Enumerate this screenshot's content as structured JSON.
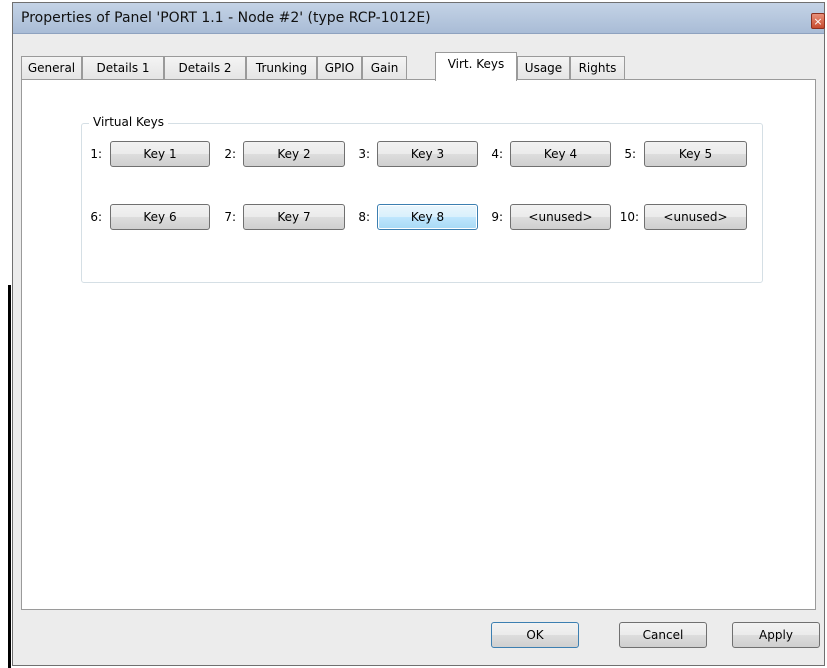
{
  "window": {
    "title": "Properties of Panel 'PORT 1.1 - Node #2' (type RCP-1012E)",
    "close_glyph": "×"
  },
  "tabs": [
    {
      "label": "General"
    },
    {
      "label": "Details 1"
    },
    {
      "label": "Details 2"
    },
    {
      "label": "Trunking"
    },
    {
      "label": "GPIO"
    },
    {
      "label": "Gain"
    },
    {
      "label": "Virt. Keys",
      "active": true
    },
    {
      "label": "Usage"
    },
    {
      "label": "Rights"
    }
  ],
  "virtual_keys": {
    "group_label": "Virtual Keys",
    "keys": [
      {
        "num": "1:",
        "label": "Key 1"
      },
      {
        "num": "2:",
        "label": "Key 2"
      },
      {
        "num": "3:",
        "label": "Key 3"
      },
      {
        "num": "4:",
        "label": "Key 4"
      },
      {
        "num": "5:",
        "label": "Key 5"
      },
      {
        "num": "6:",
        "label": "Key 6"
      },
      {
        "num": "7:",
        "label": "Key 7"
      },
      {
        "num": "8:",
        "label": "Key 8",
        "focused": true
      },
      {
        "num": "9:",
        "label": "<unused>"
      },
      {
        "num": "10:",
        "label": "<unused>"
      }
    ]
  },
  "buttons": {
    "ok": "OK",
    "cancel": "Cancel",
    "apply": "Apply"
  }
}
